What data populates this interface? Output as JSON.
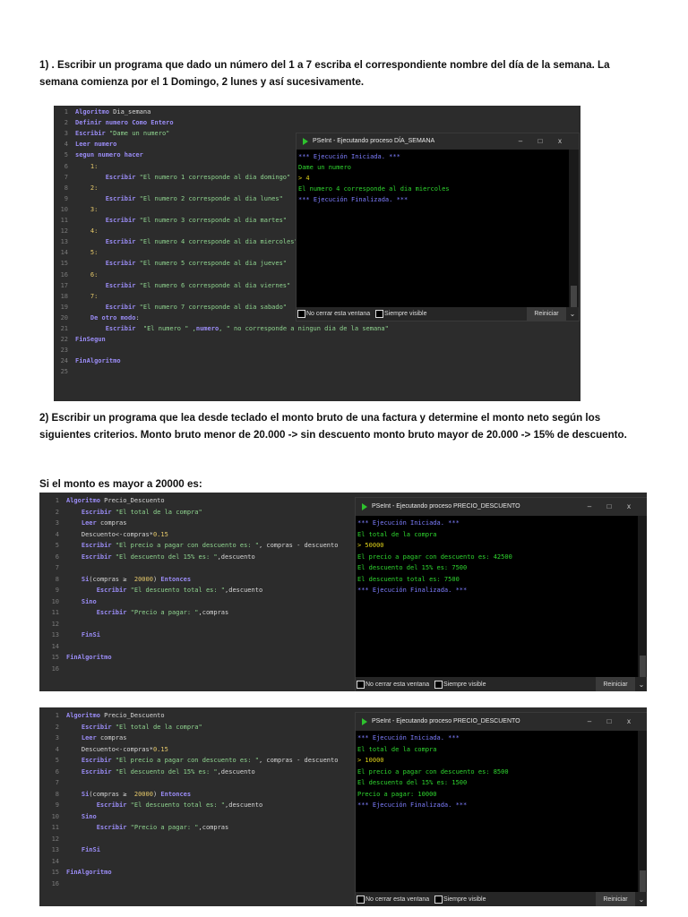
{
  "paragraphs": {
    "p1_line1": "1) . Escribir un programa que dado un número del 1 a 7 escriba el correspondiente nombre del día de la semana. La",
    "p1_line2": "semana comienza por el 1 Domingo, 2 lunes y así sucesivamente.",
    "p2_line1": "2) Escribir un programa que lea desde teclado el monto bruto de una factura y determine el monto neto según los",
    "p2_line2": "siguientes criterios. Monto bruto menor de 20.000 -> sin descuento monto bruto mayor de 20.000 -> 15% de descuento.",
    "p3": "Si el monto es mayor a 20000 es:"
  },
  "common": {
    "no_cerrar": "No cerrar esta ventana",
    "siempre_visible": "Siempre visible",
    "reiniciar": "Reiniciar",
    "minimize": "–",
    "maximize": "□",
    "close": "x"
  },
  "shots": [
    {
      "code": [
        [
          [
            "k",
            "Algoritmo "
          ],
          [
            "i",
            "Dia_semana"
          ]
        ],
        [
          [
            "k",
            "Definir numero Como Entero"
          ]
        ],
        [
          [
            "k",
            "Escribir "
          ],
          [
            "s",
            "\"Dame un numero\""
          ]
        ],
        [
          [
            "k",
            "Leer numero"
          ]
        ],
        [
          [
            "k",
            "segun numero hacer"
          ]
        ],
        [
          [
            "i",
            "    "
          ],
          [
            "n",
            "1:"
          ]
        ],
        [
          [
            "i",
            "        "
          ],
          [
            "k",
            "Escribir "
          ],
          [
            "s",
            "\"El numero 1 corresponde al dia domingo\""
          ]
        ],
        [
          [
            "i",
            "    "
          ],
          [
            "n",
            "2:"
          ]
        ],
        [
          [
            "i",
            "        "
          ],
          [
            "k",
            "Escribir "
          ],
          [
            "s",
            "\"El numero 2 corresponde al dia lunes\""
          ]
        ],
        [
          [
            "i",
            "    "
          ],
          [
            "n",
            "3:"
          ]
        ],
        [
          [
            "i",
            "        "
          ],
          [
            "k",
            "Escribir "
          ],
          [
            "s",
            "\"El numero 3 corresponde al dia martes\""
          ]
        ],
        [
          [
            "i",
            "    "
          ],
          [
            "n",
            "4:"
          ]
        ],
        [
          [
            "i",
            "        "
          ],
          [
            "k",
            "Escribir "
          ],
          [
            "s",
            "\"El numero 4 corresponde al dia miercoles\""
          ]
        ],
        [
          [
            "i",
            "    "
          ],
          [
            "n",
            "5:"
          ]
        ],
        [
          [
            "i",
            "        "
          ],
          [
            "k",
            "Escribir "
          ],
          [
            "s",
            "\"El numero 5 corresponde al dia jueves\""
          ]
        ],
        [
          [
            "i",
            "    "
          ],
          [
            "n",
            "6:"
          ]
        ],
        [
          [
            "i",
            "        "
          ],
          [
            "k",
            "Escribir "
          ],
          [
            "s",
            "\"El numero 6 corresponde al dia viernes\""
          ]
        ],
        [
          [
            "i",
            "    "
          ],
          [
            "n",
            "7:"
          ]
        ],
        [
          [
            "i",
            "        "
          ],
          [
            "k",
            "Escribir "
          ],
          [
            "s",
            "\"El numero 7 corresponde al dia sabado\""
          ]
        ],
        [
          [
            "i",
            "    "
          ],
          [
            "k",
            "De otro modo"
          ],
          [
            "i",
            ":"
          ]
        ],
        [
          [
            "i",
            "        "
          ],
          [
            "k",
            "Escribir "
          ],
          [
            "s",
            " \"El numero \" ,"
          ],
          [
            "k",
            "numero"
          ],
          [
            "s",
            ", \" no corresponde a ningun dia de la semana\""
          ]
        ],
        [
          [
            "k",
            "FinSegun"
          ]
        ],
        [],
        [
          [
            "k",
            "FinAlgoritmo"
          ]
        ],
        []
      ],
      "console": {
        "title": "PSeInt - Ejecutando proceso DÍA_SEMANA",
        "lines": [
          [
            "cb",
            "*** Ejecución Iniciada. ***"
          ],
          [
            "cg",
            "Dame un numero"
          ],
          [
            "cy",
            "> 4"
          ],
          [
            "cg",
            "El numero 4 corresponde al dia miercoles"
          ],
          [
            "cb",
            "*** Ejecución Finalizada. ***"
          ]
        ]
      }
    },
    {
      "code": [
        [
          [
            "k",
            "Algoritmo "
          ],
          [
            "i",
            "Precio_Descuento"
          ]
        ],
        [
          [
            "i",
            "    "
          ],
          [
            "k",
            "Escribir "
          ],
          [
            "s",
            "\"El total de la compra\""
          ]
        ],
        [
          [
            "i",
            "    "
          ],
          [
            "k",
            "Leer "
          ],
          [
            "i",
            "compras"
          ]
        ],
        [
          [
            "i",
            "    Descuento<-compras*"
          ],
          [
            "n",
            "0.15"
          ]
        ],
        [
          [
            "i",
            "    "
          ],
          [
            "k",
            "Escribir "
          ],
          [
            "s",
            "\"El precio a pagar con descuento es: \""
          ],
          [
            "i",
            ", compras - descuento"
          ]
        ],
        [
          [
            "i",
            "    "
          ],
          [
            "k",
            "Escribir "
          ],
          [
            "s",
            "\"El descuento del 15% es: \""
          ],
          [
            "i",
            ",descuento"
          ]
        ],
        [],
        [
          [
            "i",
            "    "
          ],
          [
            "k",
            "Si"
          ],
          [
            "i",
            "(compras ≥  "
          ],
          [
            "n",
            "20000"
          ],
          [
            "i",
            ") "
          ],
          [
            "k",
            "Entonces"
          ]
        ],
        [
          [
            "i",
            "        "
          ],
          [
            "k",
            "Escribir "
          ],
          [
            "s",
            "\"El descuento total es: \""
          ],
          [
            "i",
            ",descuento"
          ]
        ],
        [
          [
            "i",
            "    "
          ],
          [
            "k",
            "Sino"
          ]
        ],
        [
          [
            "i",
            "        "
          ],
          [
            "k",
            "Escribir "
          ],
          [
            "s",
            "\"Precio a pagar: \""
          ],
          [
            "i",
            ",compras"
          ]
        ],
        [],
        [
          [
            "i",
            "    "
          ],
          [
            "k",
            "FinSi"
          ]
        ],
        [],
        [
          [
            "k",
            "FinAlgoritmo"
          ]
        ],
        []
      ],
      "console": {
        "title": "PSeInt - Ejecutando proceso PRECIO_DESCUENTO",
        "lines": [
          [
            "cb",
            "*** Ejecución Iniciada. ***"
          ],
          [
            "cg",
            "El total de la compra"
          ],
          [
            "cy",
            "> 50000"
          ],
          [
            "cg",
            "El precio a pagar con descuento es: 42500"
          ],
          [
            "cg",
            "El descuento del 15% es: 7500"
          ],
          [
            "cg",
            "El descuento total es: 7500"
          ],
          [
            "cb",
            "*** Ejecución Finalizada. ***"
          ]
        ]
      }
    },
    {
      "code": [
        [
          [
            "k",
            "Algoritmo "
          ],
          [
            "i",
            "Precio_Descuento"
          ]
        ],
        [
          [
            "i",
            "    "
          ],
          [
            "k",
            "Escribir "
          ],
          [
            "s",
            "\"El total de la compra\""
          ]
        ],
        [
          [
            "i",
            "    "
          ],
          [
            "k",
            "Leer "
          ],
          [
            "i",
            "compras"
          ]
        ],
        [
          [
            "i",
            "    Descuento<-compras*"
          ],
          [
            "n",
            "0.15"
          ]
        ],
        [
          [
            "i",
            "    "
          ],
          [
            "k",
            "Escribir "
          ],
          [
            "s",
            "\"El precio a pagar con descuento es: \""
          ],
          [
            "i",
            ", compras - descuento"
          ]
        ],
        [
          [
            "i",
            "    "
          ],
          [
            "k",
            "Escribir "
          ],
          [
            "s",
            "\"El descuento del 15% es: \""
          ],
          [
            "i",
            ",descuento"
          ]
        ],
        [],
        [
          [
            "i",
            "    "
          ],
          [
            "k",
            "Si"
          ],
          [
            "i",
            "(compras ≥  "
          ],
          [
            "n",
            "20000"
          ],
          [
            "i",
            ") "
          ],
          [
            "k",
            "Entonces"
          ]
        ],
        [
          [
            "i",
            "        "
          ],
          [
            "k",
            "Escribir "
          ],
          [
            "s",
            "\"El descuento total es: \""
          ],
          [
            "i",
            ",descuento"
          ]
        ],
        [
          [
            "i",
            "    "
          ],
          [
            "k",
            "Sino"
          ]
        ],
        [
          [
            "i",
            "        "
          ],
          [
            "k",
            "Escribir "
          ],
          [
            "s",
            "\"Precio a pagar: \""
          ],
          [
            "i",
            ",compras"
          ]
        ],
        [],
        [
          [
            "i",
            "    "
          ],
          [
            "k",
            "FinSi"
          ]
        ],
        [],
        [
          [
            "k",
            "FinAlgoritmo"
          ]
        ],
        []
      ],
      "console": {
        "title": "PSeInt - Ejecutando proceso PRECIO_DESCUENTO",
        "lines": [
          [
            "cb",
            "*** Ejecución Iniciada. ***"
          ],
          [
            "cg",
            "El total de la compra"
          ],
          [
            "cy",
            "> 10000"
          ],
          [
            "cg",
            "El precio a pagar con descuento es: 8500"
          ],
          [
            "cg",
            "El descuento del 15% es: 1500"
          ],
          [
            "cg",
            "Precio a pagar: 10000"
          ],
          [
            "cb",
            "*** Ejecución Finalizada. ***"
          ]
        ]
      }
    }
  ]
}
